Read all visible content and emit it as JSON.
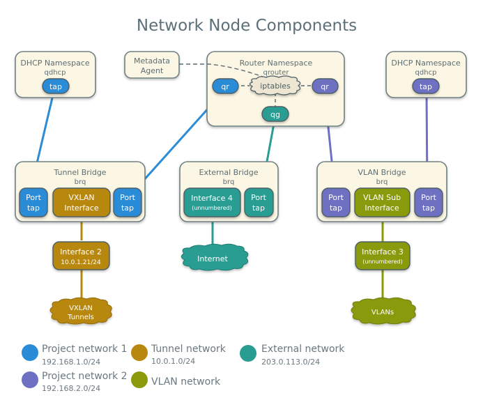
{
  "title": "Network Node Components",
  "colors": {
    "project1": "#2a8bd6",
    "project2": "#6e70c2",
    "tunnel": "#b8870d",
    "external": "#2a9d92",
    "vlan": "#8a9a0b",
    "box_fill": "#fcf6e4",
    "box_stroke": "#6f8083"
  },
  "dhcp_left": {
    "title": "DHCP Namespace",
    "subtitle": "qdhcp",
    "port": "tap"
  },
  "dhcp_right": {
    "title": "DHCP Namespace",
    "subtitle": "qdhcp",
    "port": "tap"
  },
  "metadata_agent": {
    "line1": "Metadata",
    "line2": "Agent"
  },
  "router": {
    "title": "Router Namespace",
    "subtitle": "qrouter",
    "qr_left": "qr",
    "iptables": "iptables",
    "qr_right": "qr",
    "qg": "qg"
  },
  "tunnel_bridge": {
    "title": "Tunnel Bridge",
    "subtitle": "brq",
    "port_left": {
      "line1": "Port",
      "line2": "tap"
    },
    "vxlan": {
      "line1": "VXLAN",
      "line2": "Interface"
    },
    "port_right": {
      "line1": "Port",
      "line2": "tap"
    }
  },
  "external_bridge": {
    "title": "External Bridge",
    "subtitle": "brq",
    "iface": {
      "line1": "Interface 4",
      "line2": "(unnumbered)"
    },
    "port": {
      "line1": "Port",
      "line2": "tap"
    }
  },
  "vlan_bridge": {
    "title": "VLAN Bridge",
    "subtitle": "brq",
    "port_left": {
      "line1": "Port",
      "line2": "tap"
    },
    "sub": {
      "line1": "VLAN Sub",
      "line2": "Interface"
    },
    "port_right": {
      "line1": "Port",
      "line2": "tap"
    }
  },
  "interface2": {
    "line1": "Interface 2",
    "line2": "10.0.1.21/24"
  },
  "interface3": {
    "line1": "Interface 3",
    "line2": "(unnumbered)"
  },
  "clouds": {
    "vxlan": {
      "line1": "VXLAN",
      "line2": "Tunnels"
    },
    "internet": "Internet",
    "vlans": "VLANs"
  },
  "legend": [
    {
      "label": "Project network 1",
      "sub": "192.168.1.0/24",
      "color": "#2a8bd6"
    },
    {
      "label": "Tunnel network",
      "sub": "10.0.1.0/24",
      "color": "#b8870d"
    },
    {
      "label": "External network",
      "sub": "203.0.113.0/24",
      "color": "#2a9d92"
    },
    {
      "label": "Project network 2",
      "sub": "192.168.2.0/24",
      "color": "#6e70c2"
    },
    {
      "label": "VLAN network",
      "sub": "",
      "color": "#8a9a0b"
    }
  ]
}
